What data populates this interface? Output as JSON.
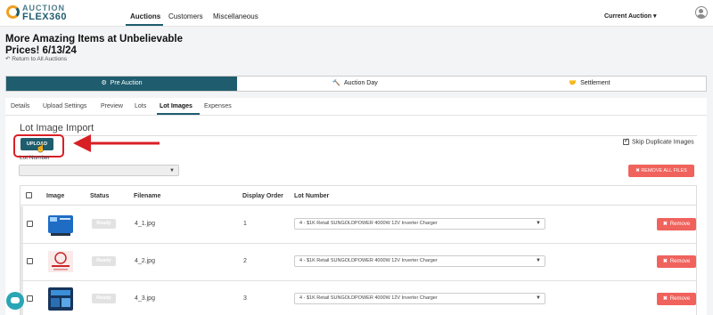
{
  "logo": {
    "line1": "AUCTION",
    "line2": "FLEX360"
  },
  "nav": {
    "items": [
      "Auctions",
      "Customers",
      "Miscellaneous"
    ],
    "current_auction": "Current Auction ▾"
  },
  "header": {
    "title": "More Amazing Items at Unbelievable Prices! 6/13/24",
    "return_link": "↶ Return to All Auctions"
  },
  "stages": [
    {
      "label": "Pre Auction",
      "icon": "gear-icon"
    },
    {
      "label": "Auction Day",
      "icon": "gavel-icon"
    },
    {
      "label": "Settlement",
      "icon": "handshake-icon"
    }
  ],
  "tabs": [
    "Details",
    "Upload Settings",
    "Preview",
    "Lots",
    "Lot Images",
    "Expenses"
  ],
  "section": {
    "title": "Lot Image Import",
    "upload_label": "UPLOAD",
    "lot_number_label": "Lot Number",
    "skip_duplicate_label": "Skip Duplicate Images",
    "remove_all_label": "✖ REMOVE ALL FILES"
  },
  "table": {
    "headers": [
      "Image",
      "Status",
      "Filename",
      "Display Order",
      "Lot Number"
    ],
    "rows": [
      {
        "status": "Ready",
        "filename": "4_1.jpg",
        "order": "1",
        "lot": "4 - $1K Retail SUNGOLDPOWER 4000W 12V Inverter Charger",
        "remove": "Remove"
      },
      {
        "status": "Ready",
        "filename": "4_2.jpg",
        "order": "2",
        "lot": "4 - $1K Retail SUNGOLDPOWER 4000W 12V Inverter Charger",
        "remove": "Remove"
      },
      {
        "status": "Ready",
        "filename": "4_3.jpg",
        "order": "3",
        "lot": "4 - $1K Retail SUNGOLDPOWER 4000W 12V Inverter Charger",
        "remove": "Remove"
      }
    ]
  },
  "colors": {
    "primary": "#1f5d6e",
    "danger": "#f0625c",
    "highlight": "#d91f26",
    "chat": "#2aa5b5"
  }
}
